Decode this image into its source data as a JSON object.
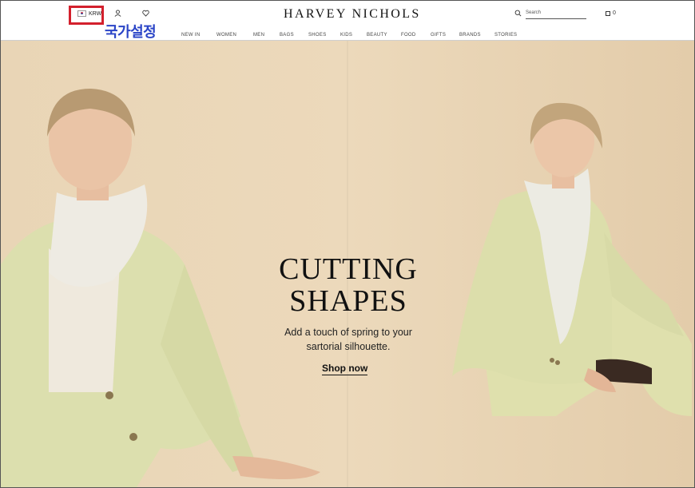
{
  "header": {
    "currency_label": "KRW",
    "annotation_label": "국가설정",
    "logo": "HARVEY NICHOLS",
    "search_placeholder": "Search",
    "bag_count": "0"
  },
  "nav": {
    "items": [
      "NEW IN",
      "WOMEN",
      "MEN",
      "BAGS",
      "SHOES",
      "KIDS",
      "BEAUTY",
      "FOOD",
      "GIFTS",
      "BRANDS",
      "STORIES"
    ]
  },
  "hero": {
    "title_line1": "CUTTING",
    "title_line2": "SHAPES",
    "subtitle_line1": "Add a touch of spring to your",
    "subtitle_line2": "sartorial silhouette.",
    "cta": "Shop now"
  },
  "colors": {
    "highlight": "#d3202d",
    "annotation": "#2b45c7",
    "hero_bg": "#e9d5b6",
    "suit": "#dfe0b0"
  }
}
